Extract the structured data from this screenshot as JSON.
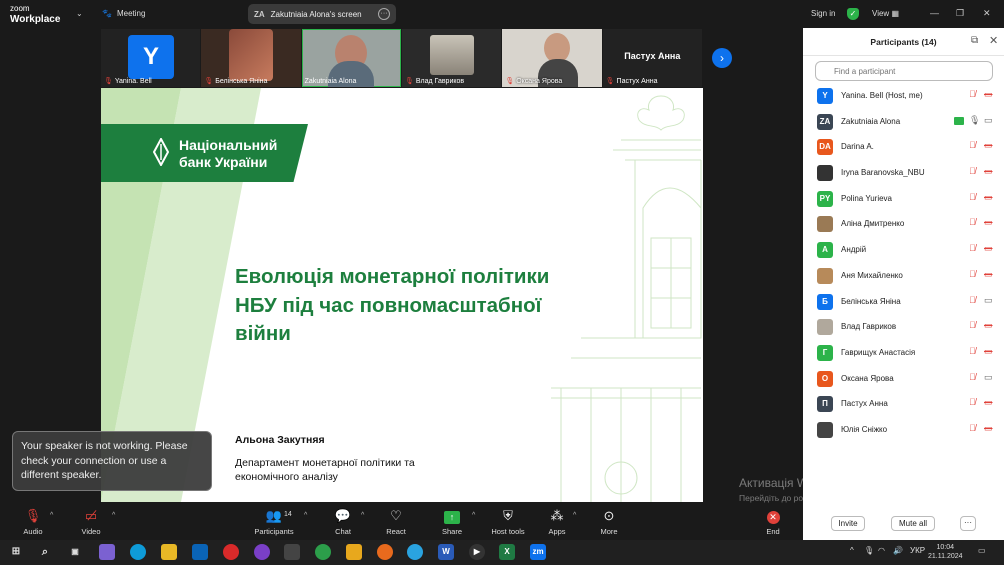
{
  "topbar": {
    "brand_line1": "zoom",
    "brand_line2": "Workplace",
    "meeting_label": "Meeting",
    "screen_initials": "ZA",
    "screen_label": "Zakutniaia Alona's screen",
    "signin_label": "Sign in",
    "view_label": "View"
  },
  "strip": {
    "tiles": [
      {
        "name": "Yanina. Bell",
        "avatar_letter": "Y"
      },
      {
        "name": "Белінська Яніна"
      },
      {
        "name": "Zakutniaia Alona"
      },
      {
        "name": "Влад Гавриков"
      },
      {
        "name": "Оксана Ярова"
      },
      {
        "name": "Пастух Анна",
        "big_name": "Пастух Анна"
      }
    ]
  },
  "slide": {
    "bank_line1": "Національний",
    "bank_line2": "банк України",
    "title": "Еволюція монетарної політики НБУ під час повномасштабної війни",
    "author": "Альона Закутняя",
    "department": "Департамент монетарної політики та економічного аналізу"
  },
  "toast": {
    "message": "Your speaker is not working. Please check your connection or use a different speaker."
  },
  "activate": {
    "line1": "Активація Windows",
    "line2": "Перейдіть до розділу \"Настройки\", щоб активувати Windows."
  },
  "toolbar": {
    "audio": "Audio",
    "video": "Video",
    "participants": "Participants",
    "participants_count": "14",
    "chat": "Chat",
    "react": "React",
    "share": "Share",
    "host_tools": "Host tools",
    "apps": "Apps",
    "more": "More",
    "end": "End"
  },
  "panel": {
    "title": "Participants (14)",
    "search_placeholder": "Find a participant",
    "invite": "Invite",
    "mute_all": "Mute all",
    "more": "···",
    "participants": [
      {
        "name": "Yanina. Bell (Host, me)",
        "initials": "Y",
        "color": "#0e72ed",
        "mic": "off",
        "cam": "off"
      },
      {
        "name": "Zakutniaia Alona",
        "initials": "ZA",
        "color": "#3b4654",
        "mic": "on",
        "cam": "on",
        "sharing": true
      },
      {
        "name": "Darina A.",
        "initials": "DA",
        "color": "#e8571d",
        "mic": "off",
        "cam": "off"
      },
      {
        "name": "Iryna Baranovska_NBU",
        "initials": "",
        "color": "#333333",
        "mic": "off",
        "cam": "off"
      },
      {
        "name": "Polina Yurieva",
        "initials": "PY",
        "color": "#2cb34a",
        "mic": "off",
        "cam": "off"
      },
      {
        "name": "Аліна Дмитренко",
        "initials": "",
        "color": "#9a7a55",
        "mic": "off",
        "cam": "off"
      },
      {
        "name": "Андрій",
        "initials": "А",
        "color": "#2cb34a",
        "mic": "off",
        "cam": "off"
      },
      {
        "name": "Аня Михайленко",
        "initials": "",
        "color": "#b78a5a",
        "mic": "off",
        "cam": "off"
      },
      {
        "name": "Белінська Яніна",
        "initials": "Б",
        "color": "#0e72ed",
        "mic": "off",
        "cam": "on"
      },
      {
        "name": "Влад Гавриков",
        "initials": "",
        "color": "#b0a89c",
        "mic": "off",
        "cam": "off"
      },
      {
        "name": "Гаврищук Анастасія",
        "initials": "Г",
        "color": "#2cb34a",
        "mic": "off",
        "cam": "off"
      },
      {
        "name": "Оксана Ярова",
        "initials": "О",
        "color": "#e8571d",
        "mic": "off",
        "cam": "on"
      },
      {
        "name": "Пастух Анна",
        "initials": "П",
        "color": "#3b4654",
        "mic": "off",
        "cam": "off"
      },
      {
        "name": "Юлія Сніжко",
        "initials": "",
        "color": "#444444",
        "mic": "off",
        "cam": "off"
      }
    ]
  },
  "taskbar": {
    "lang": "УКР",
    "time": "10:04",
    "date": "21.11.2024"
  }
}
